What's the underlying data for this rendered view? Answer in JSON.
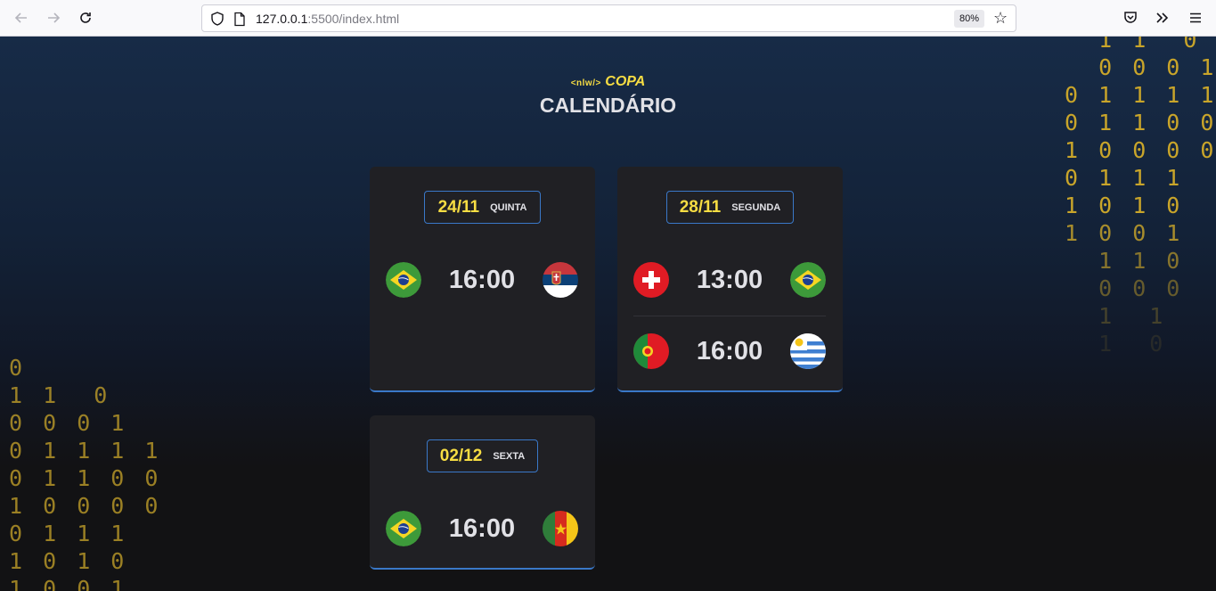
{
  "browser": {
    "url_host": "127.0.0.1",
    "url_rest": ":5500/index.html",
    "zoom": "80%"
  },
  "background": {
    "left_binary": [
      "0",
      "1 1  0",
      "0 0 0 1",
      "0 1 1 1 1",
      "0 1 1 0 0",
      "1 0 0 0 0",
      "0 1 1 1",
      "1 0 1 0",
      "1 0 0 1"
    ],
    "right_binary": [
      "  1 1  0",
      "  0 0 0 1",
      "0 1 1 1 1",
      "0 1 1 0 0",
      "1 0 0 0 0",
      "0 1 1 1",
      "1 0 1 0",
      "1 0 0 1",
      "  1 1 0",
      "  0 0 0",
      "  1  1",
      "  1  0"
    ]
  },
  "header": {
    "logo_tag": "<nlw/>",
    "logo_copa": "COPA",
    "title": "CALENDÁRIO"
  },
  "cards": [
    {
      "date": "24/11",
      "weekday": "QUINTA",
      "matches": [
        {
          "home": "brazil-flag",
          "time": "16:00",
          "away": "serbia-flag"
        }
      ]
    },
    {
      "date": "28/11",
      "weekday": "SEGUNDA",
      "matches": [
        {
          "home": "switzerland-flag",
          "time": "13:00",
          "away": "brazil-flag"
        },
        {
          "home": "portugal-flag",
          "time": "16:00",
          "away": "uruguay-flag"
        }
      ]
    },
    {
      "date": "02/12",
      "weekday": "SEXTA",
      "matches": [
        {
          "home": "brazil-flag",
          "time": "16:00",
          "away": "cameroon-flag"
        }
      ]
    }
  ],
  "colors": {
    "accent_yellow": "#f7dd43",
    "accent_blue": "#3a78c8",
    "card_bg": "#202024",
    "text": "#e1e1e6"
  }
}
